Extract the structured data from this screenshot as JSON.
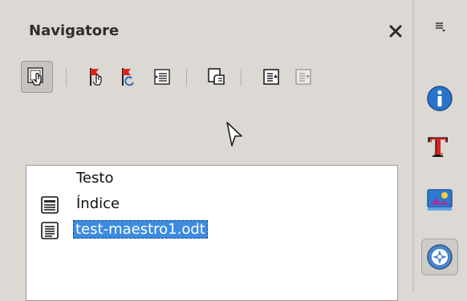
{
  "navigator": {
    "title": "Navigatore",
    "toolbar": [
      {
        "icon": "toggle-master-view-icon",
        "pressed": true
      },
      {
        "icon": "edit-navigation-icon"
      },
      {
        "icon": "update-icon"
      },
      {
        "icon": "insert-icon"
      },
      {
        "icon": "save-contents-icon"
      },
      {
        "icon": "move-up-icon"
      },
      {
        "icon": "move-down-icon",
        "disabled": true
      }
    ],
    "tree": [
      {
        "label": "Testo",
        "icon": null
      },
      {
        "label": "Índice",
        "icon": "index-icon"
      },
      {
        "label": "test-maestro1.odt",
        "icon": "file-icon",
        "selected": true
      }
    ]
  },
  "sidebar": {
    "buttons": [
      "properties-icon",
      "styles-icon",
      "gallery-icon",
      "navigator-icon"
    ]
  },
  "colors": {
    "selection": "#3c8be0",
    "background": "#dcd8d4"
  }
}
